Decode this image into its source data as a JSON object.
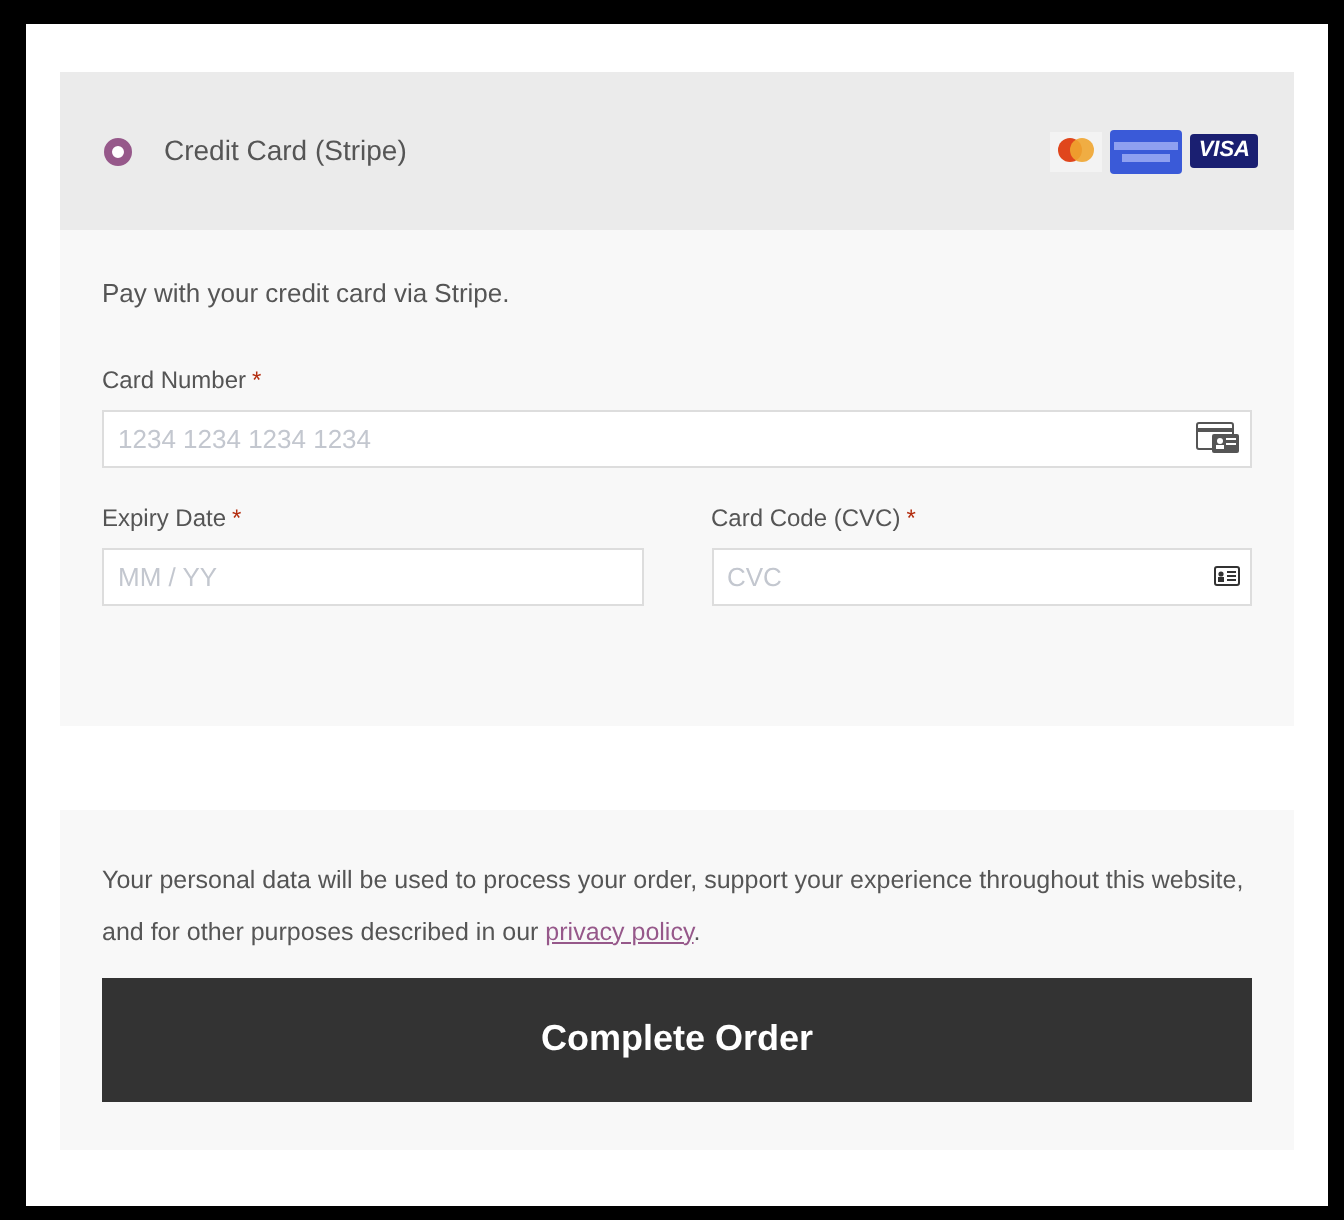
{
  "payment_method": {
    "label": "Credit Card (Stripe)",
    "selected": true,
    "card_logos": [
      {
        "kind": "mastercard"
      },
      {
        "kind": "amex"
      },
      {
        "kind": "visa",
        "label": "VISA"
      }
    ]
  },
  "description": "Pay with your credit card via Stripe.",
  "fields": [
    {
      "label": "Card Number",
      "required_mark": "*",
      "placeholder": "1234 1234 1234 1234",
      "kind": "card"
    },
    {
      "label": "Expiry Date",
      "required_mark": "*",
      "placeholder": "MM / YY"
    },
    {
      "label": "Card Code (CVC)",
      "required_mark": "*",
      "placeholder": "CVC",
      "kind": "cvc"
    }
  ],
  "privacy": {
    "text": "Your personal data will be used to process your order, support your experience throughout this website, and for other purposes described in our ",
    "link": "privacy policy",
    "after": "."
  },
  "submit_button": "Complete Order"
}
